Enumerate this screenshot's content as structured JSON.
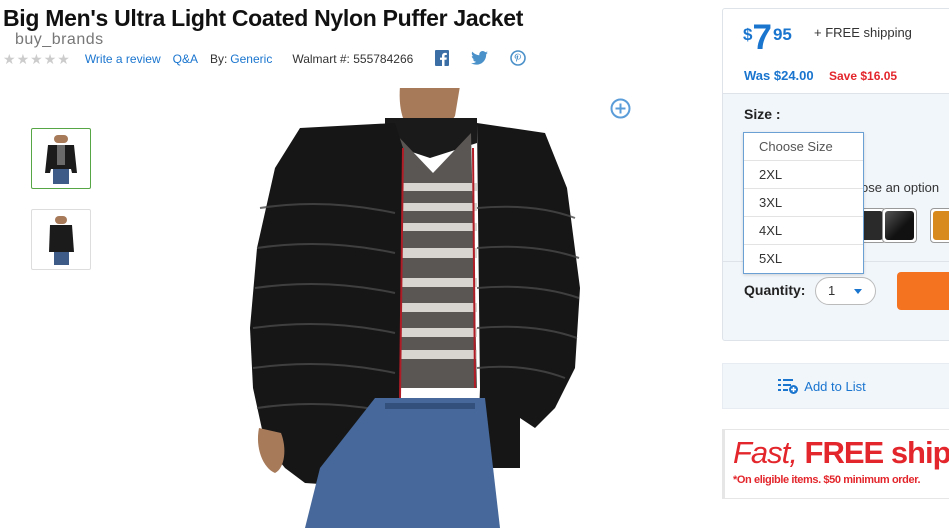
{
  "product": {
    "title": "Big Men's Ultra Light Coated Nylon Puffer Jacket",
    "watermark": "buy_brands"
  },
  "meta": {
    "rating": 0,
    "stars_total": 5,
    "write_review": "Write a review",
    "qa": "Q&A",
    "by_label": "By:",
    "brand": "Generic",
    "walmart_number": "Walmart #: 555784266",
    "social_icons": [
      "facebook-icon",
      "twitter-icon",
      "pinterest-icon"
    ]
  },
  "gallery": {
    "thumbnails": [
      "front-view",
      "side-view"
    ],
    "selected_index": 0,
    "zoom_icon": "zoom-in-icon"
  },
  "pricing": {
    "currency": "$",
    "dollars": "7",
    "cents": "95",
    "shipping": "+ FREE shipping",
    "was": "Was $24.00",
    "save": "Save $16.05"
  },
  "options": {
    "size_label": "Size :",
    "size_dropdown": {
      "placeholder": "Choose Size",
      "items": [
        "2XL",
        "3XL",
        "4XL",
        "5XL"
      ]
    },
    "color_hint_partial": "ose an option",
    "swatch_colors": [
      "#2a2a2a",
      "#1e1e1e",
      "#d98a1c"
    ]
  },
  "quantity": {
    "label": "Quantity:",
    "value": "1"
  },
  "add_to_list": "Add to List",
  "banner": {
    "fast": "Fast,",
    "free_shipping": "FREE shipping",
    "sub": "*On eligible items. $50 minimum order."
  },
  "colors": {
    "link_blue": "#1a75cf",
    "sale_red": "#e3262c",
    "cart_orange": "#f47321",
    "selected_green": "#57a645"
  }
}
